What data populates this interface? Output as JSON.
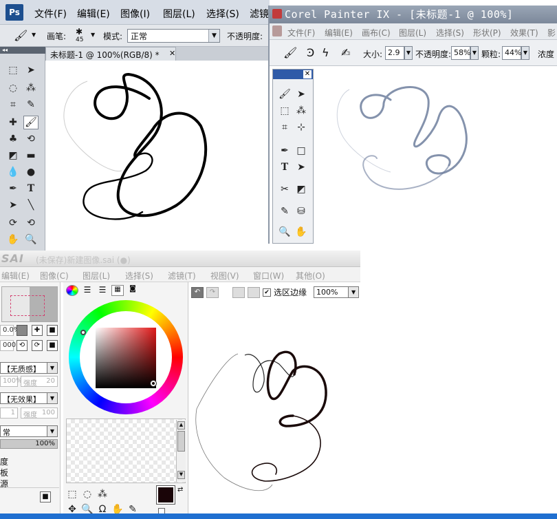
{
  "photoshop": {
    "logo": "Ps",
    "menu": [
      "文件(F)",
      "编辑(E)",
      "图像(I)",
      "图层(L)",
      "选择(S)",
      "滤镜"
    ],
    "options": {
      "brush_label": "画笔:",
      "brush_size": "45",
      "mode_label": "模式:",
      "mode_value": "正常",
      "opacity_label": "不透明度:"
    },
    "doc_tab": "未标题-1 @ 100%(RGB/8) *",
    "tools": [
      "marquee-icon",
      "move-icon",
      "lasso-icon",
      "magic-wand-icon",
      "crop-icon",
      "eyedropper-icon",
      "healing-icon",
      "brush-icon",
      "stamp-icon",
      "history-brush-icon",
      "eraser-icon",
      "gradient-icon",
      "blur-icon",
      "dodge-icon",
      "pen-icon",
      "type-icon",
      "path-select-icon",
      "line-icon",
      "3d-rotate-icon",
      "3d-orbit-icon",
      "hand-icon",
      "zoom-icon"
    ],
    "type_tool_glyph": "T"
  },
  "painter": {
    "title": "Corel Painter IX - [未标题-1 @ 100%]",
    "menu": [
      "文件(F)",
      "编辑(E)",
      "画布(C)",
      "图层(L)",
      "选择(S)",
      "形状(P)",
      "效果(T)",
      "影"
    ],
    "props": {
      "size_label": "大小:",
      "size_value": "2.9",
      "opacity_label": "不透明度:",
      "opacity_value": "58%",
      "grain_label": "颗粒:",
      "grain_value": "44%",
      "concentration_label": "浓度"
    },
    "type_tool_glyph": "T",
    "close_glyph": "✕"
  },
  "sai": {
    "logo": "SAI",
    "title": "(未保存)新建图像.sai (●)",
    "menu": [
      "编辑(E)",
      "图像(C)",
      "图层(L)",
      "选择(S)",
      "滤镜(T)",
      "视图(V)",
      "窗口(W)",
      "其他(O)"
    ],
    "zoom_row": {
      "value_a": "0.0%",
      "value_b": "000"
    },
    "texture_select": "【无质感】",
    "texture_opacity": "100%",
    "texture_strength_label": "强度",
    "texture_strength": "20",
    "effect_select": "【无效果】",
    "effect_width": "1",
    "effect_strength_label": "强度",
    "effect_strength": "100",
    "blend_select": "常",
    "opacity_value": "100%",
    "left_labels": [
      "度",
      "板",
      "源"
    ],
    "selection_edge_label": "选区边缘",
    "canvas_zoom": "100%"
  },
  "colors": {
    "ps_menubar": "#d7dde6",
    "painter_title": "#8592a4",
    "painter_toolbox_title": "#2e5aa8",
    "sai_fg_color": "#1a0508",
    "stroke_ps": "#000000",
    "stroke_painter": "#6f7f9e",
    "stroke_sai": "#1a0a0a"
  }
}
